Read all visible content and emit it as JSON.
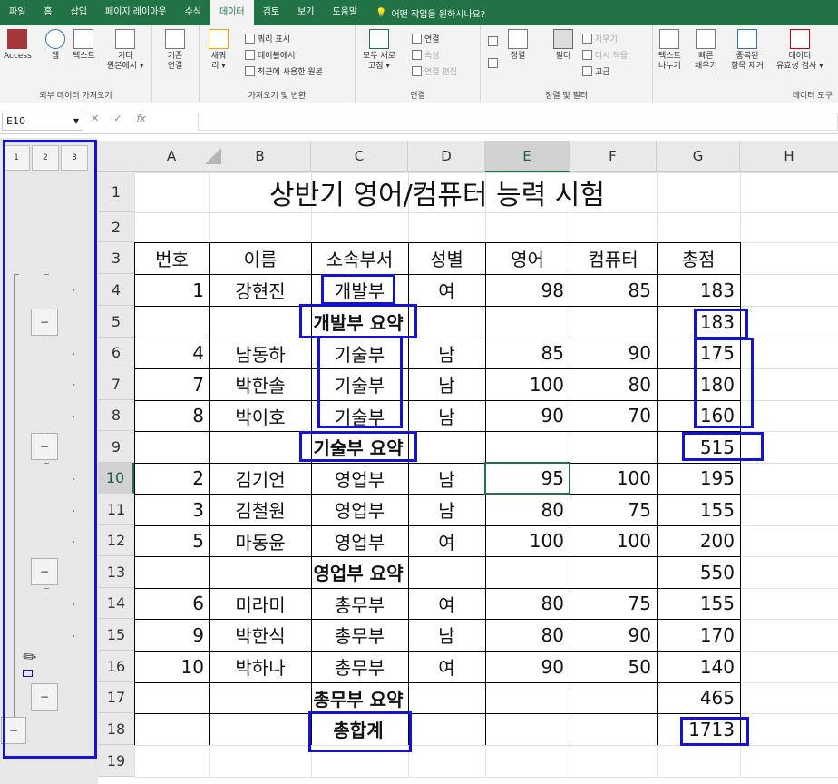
{
  "tabs": [
    "파일",
    "홈",
    "삽입",
    "페이지 레이아웃",
    "수식",
    "데이터",
    "검토",
    "보기",
    "도움말"
  ],
  "active_tab": "데이터",
  "tell_me": "어떤 작업을 원하시나요?",
  "ribbon": {
    "external": {
      "label": "외부 데이터 가져오기",
      "access": "Access",
      "web": "웹",
      "text": "텍스트",
      "other": "기타",
      "other2": "원본에서 ▾"
    },
    "existing": {
      "l1": "기존",
      "l2": "연결"
    },
    "get": {
      "label": "가져오기 및 변환",
      "new1": "새쿼",
      "new2": "리 ▾",
      "show_query": "쿼리 표시",
      "from_table": "테이블에서",
      "recent": "최근에 사용한 원본"
    },
    "connections": {
      "label": "연결",
      "refresh1": "모두 새로",
      "refresh2": "고침 ▾",
      "conn": "연결",
      "props": "속성",
      "edit": "연결 편집"
    },
    "sort": {
      "label": "정렬 및 필터",
      "sort": "정렬",
      "filter": "필터",
      "clear": "지우기",
      "reapply": "다시 적용",
      "advanced": "고급"
    },
    "tools": {
      "label": "데이터 도구",
      "split1": "텍스트",
      "split2": "나누기",
      "flash1": "빠른",
      "flash2": "채우기",
      "dup1": "중복된",
      "dup2": "항목 제거",
      "valid1": "데이터",
      "valid2": "유효성 검사 ▾"
    }
  },
  "name_box": "E10",
  "fx": "fx",
  "outline_levels": [
    "1",
    "2",
    "3"
  ],
  "columns": [
    "A",
    "B",
    "C",
    "D",
    "E",
    "F",
    "G",
    "H"
  ],
  "rows": [
    "1",
    "2",
    "3",
    "4",
    "5",
    "6",
    "7",
    "8",
    "9",
    "10",
    "11",
    "12",
    "13",
    "14",
    "15",
    "16",
    "17",
    "18",
    "19"
  ],
  "sheet": {
    "title": "상반기 영어/컴퓨터 능력 시험",
    "headers": [
      "번호",
      "이름",
      "소속부서",
      "성별",
      "영어",
      "컴퓨터",
      "총점"
    ],
    "r4": [
      "1",
      "강현진",
      "개발부",
      "여",
      "98",
      "85",
      "183"
    ],
    "r5": {
      "label": "개발부 요약",
      "total": "183"
    },
    "r6": [
      "4",
      "남동하",
      "기술부",
      "남",
      "85",
      "90",
      "175"
    ],
    "r7": [
      "7",
      "박한솔",
      "기술부",
      "남",
      "100",
      "80",
      "180"
    ],
    "r8": [
      "8",
      "박이호",
      "기술부",
      "남",
      "90",
      "70",
      "160"
    ],
    "r9": {
      "label": "기술부 요약",
      "total": "515"
    },
    "r10": [
      "2",
      "김기언",
      "영업부",
      "남",
      "95",
      "100",
      "195"
    ],
    "r11": [
      "3",
      "김철원",
      "영업부",
      "남",
      "80",
      "75",
      "155"
    ],
    "r12": [
      "5",
      "마동윤",
      "영업부",
      "여",
      "100",
      "100",
      "200"
    ],
    "r13": {
      "label": "영업부 요약",
      "total": "550"
    },
    "r14": [
      "6",
      "미라미",
      "총무부",
      "여",
      "80",
      "75",
      "155"
    ],
    "r15": [
      "9",
      "박한식",
      "총무부",
      "남",
      "80",
      "90",
      "170"
    ],
    "r16": [
      "10",
      "박하나",
      "총무부",
      "여",
      "90",
      "50",
      "140"
    ],
    "r17": {
      "label": "총무부 요약",
      "total": "465"
    },
    "r18": {
      "label": "총합계",
      "total": "1713"
    }
  },
  "outline_minus": "−",
  "colors": {
    "excel_green": "#217346",
    "annotation_blue": "#1414d0"
  }
}
